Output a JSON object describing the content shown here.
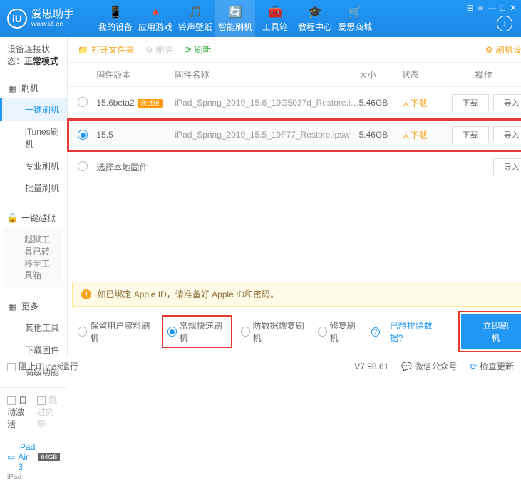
{
  "brand": {
    "cn": "爱思助手",
    "url": "www.i4.cn",
    "logo": "iU"
  },
  "nav": [
    {
      "icon": "📱",
      "label": "我的设备"
    },
    {
      "icon": "🔺",
      "label": "应用游戏"
    },
    {
      "icon": "🎵",
      "label": "铃声壁纸"
    },
    {
      "icon": "🔄",
      "label": "智能刷机",
      "active": true
    },
    {
      "icon": "🧰",
      "label": "工具箱"
    },
    {
      "icon": "🎓",
      "label": "教程中心"
    },
    {
      "icon": "🛒",
      "label": "爱思商城"
    }
  ],
  "sidebar": {
    "status_label": "设备连接状态：",
    "status_value": "正常模式",
    "sec1": {
      "title": "刷机",
      "items": [
        "一键刷机",
        "iTunes刷机",
        "专业刷机",
        "批量刷机"
      ],
      "active": 0
    },
    "sec2": {
      "title": "一键越狱",
      "note": "越狱工具已转移至工具箱"
    },
    "sec3": {
      "title": "更多",
      "items": [
        "其他工具",
        "下载固件",
        "高级功能"
      ]
    },
    "auto_activate": "自动激活",
    "skip_guide": "跳过向导",
    "device": {
      "name": "iPad Air 3",
      "storage": "64GB",
      "sub": "iPad"
    }
  },
  "toolbar": {
    "open": "打开文件夹",
    "delete": "删除",
    "refresh": "刷新",
    "settings": "刷机设置"
  },
  "columns": {
    "version": "固件版本",
    "name": "固件名称",
    "size": "大小",
    "status": "状态",
    "ops": "操作"
  },
  "rows": [
    {
      "selected": false,
      "version": "15.6beta2",
      "beta": "测试版",
      "name": "iPad_Spring_2019_15.6_19G5037d_Restore.i…",
      "size": "5.46GB",
      "status": "未下载"
    },
    {
      "selected": true,
      "version": "15.5",
      "beta": "",
      "name": "iPad_Spring_2019_15.5_19F77_Restore.ipsw",
      "size": "5.46GB",
      "status": "未下载"
    }
  ],
  "local_row": "选择本地固件",
  "btn": {
    "download": "下载",
    "import": "导入"
  },
  "alert": {
    "icon": "!",
    "text": "如已绑定 Apple ID，请准备好 Apple ID和密码。"
  },
  "modes": {
    "keep": "保留用户资料刷机",
    "normal": "常规快速刷机",
    "dfu": "防数据恢复刷机",
    "repair": "修复刷机",
    "exclude": "已想排除数据?",
    "go": "立即刷机"
  },
  "footer": {
    "block": "阻止iTunes运行",
    "version": "V7.98.61",
    "wechat": "微信公众号",
    "update": "检查更新"
  }
}
